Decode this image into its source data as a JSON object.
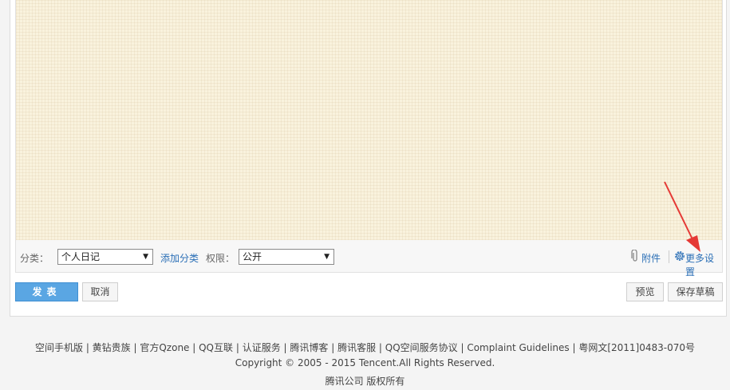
{
  "toolbar": {
    "category_label": "分类：",
    "category_value": "个人日记",
    "add_category": "添加分类",
    "permission_label": "权限：",
    "permission_value": "公开",
    "attach_label": "附件",
    "more_settings_label": "更多设置"
  },
  "actions": {
    "publish": "发表",
    "cancel": "取消",
    "preview": "预览",
    "save_draft": "保存草稿"
  },
  "footer": {
    "links": [
      "空间手机版",
      "黄钻贵族",
      "官方Qzone",
      "QQ互联",
      "认证服务",
      "腾讯博客",
      "腾讯客服",
      "QQ空间服务协议",
      "Complaint Guidelines",
      "粤网文[2011]0483-070号"
    ],
    "copyright": "Copyright © 2005 - 2015 Tencent.All Rights Reserved.",
    "company": "腾讯公司 版权所有"
  },
  "colors": {
    "editor_bg": "#f9f2dd",
    "accent": "#5aa6e3",
    "link": "#2b6fb6",
    "annotation_arrow": "#e53935"
  },
  "icons": [
    "paperclip-icon",
    "gear-icon",
    "chevron-down-icon"
  ]
}
